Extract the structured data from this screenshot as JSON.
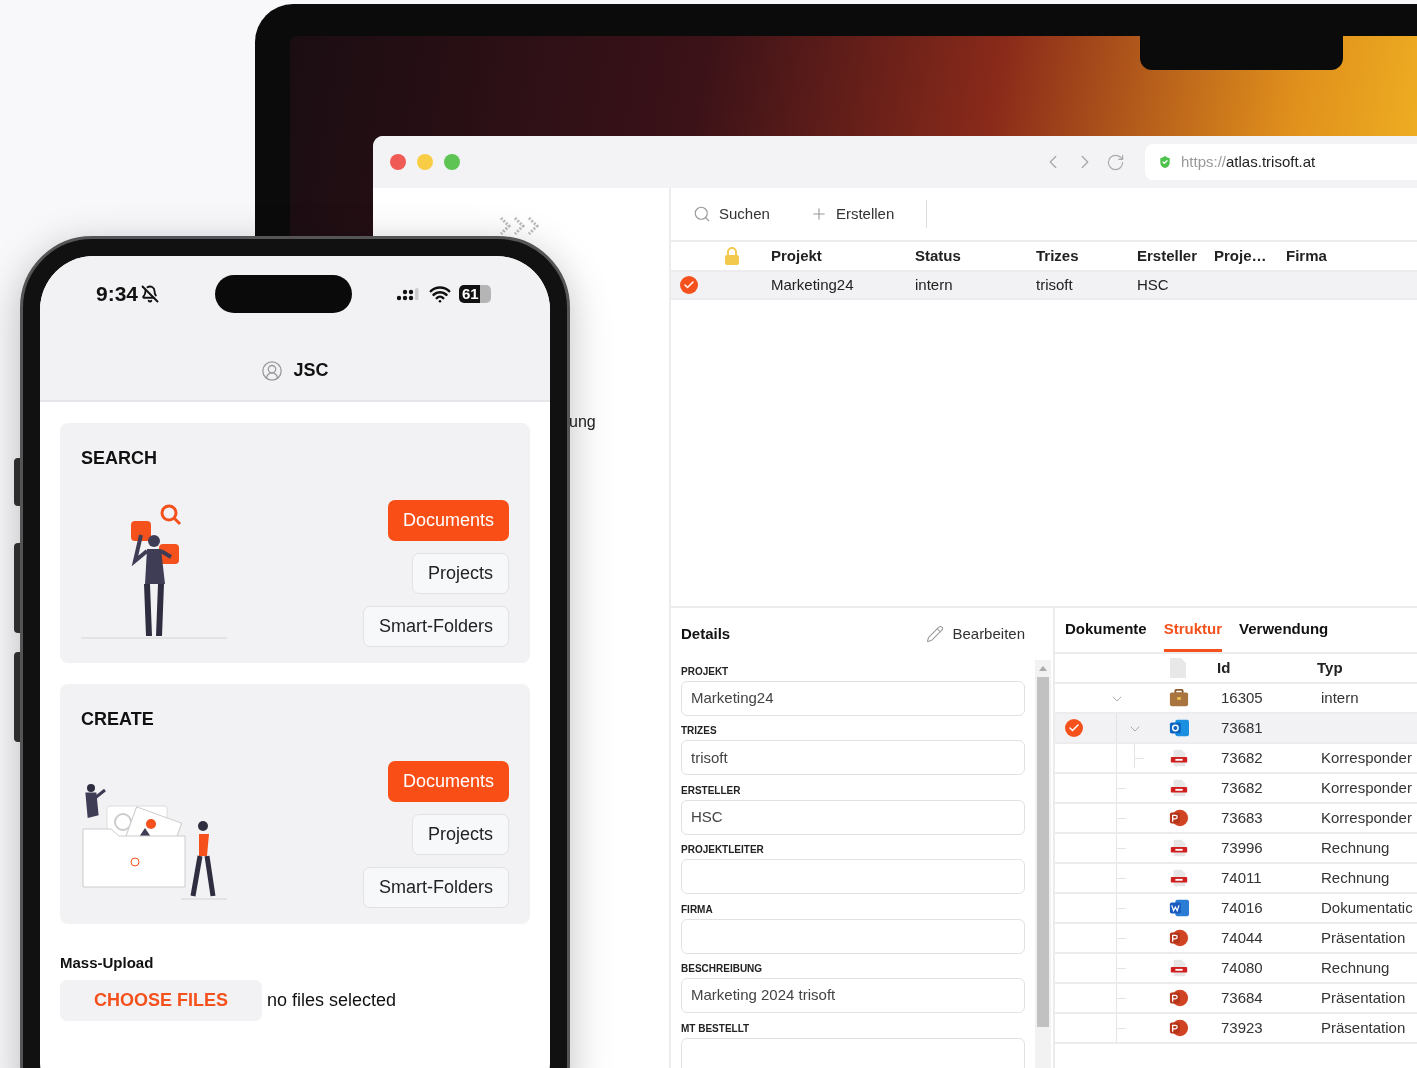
{
  "browser": {
    "url_scheme": "https://",
    "url_host": "atlas.trisoft.at"
  },
  "sidebar": {
    "partial_label": "ung"
  },
  "toolbar": [
    {
      "kind": "search",
      "label": "Suchen"
    },
    {
      "kind": "create",
      "label": "Erstellen"
    }
  ],
  "projects_table": {
    "columns": [
      "Projekt",
      "Status",
      "Trizes",
      "Ersteller",
      "Proje…",
      "Firma"
    ],
    "rows": [
      {
        "selected": true,
        "cells": [
          "Marketing24",
          "intern",
          "trisoft",
          "HSC"
        ]
      }
    ]
  },
  "details": {
    "title": "Details",
    "edit": "Bearbeiten",
    "fields": [
      {
        "label": "PROJEKT",
        "value": "Marketing24"
      },
      {
        "label": "TRIZES",
        "value": "trisoft"
      },
      {
        "label": "ERSTELLER",
        "value": "HSC"
      },
      {
        "label": "PROJEKTLEITER"
      },
      {
        "label": "FIRMA"
      },
      {
        "label": "BESCHREIBUNG",
        "value": "Marketing 2024 trisoft"
      },
      {
        "label": "MT BESTELLT"
      }
    ]
  },
  "structure": {
    "tabs": [
      {
        "label": "Dokumente",
        "selected": false
      },
      {
        "label": "Struktur",
        "selected": true
      },
      {
        "label": "Verwendung",
        "selected": false
      }
    ],
    "columns": [
      "Id",
      "Typ"
    ],
    "rows": [
      {
        "kind": "briefcase",
        "id": "16305",
        "typ": "intern",
        "selected": false,
        "expanded": true,
        "children": [
          {
            "kind": "outlook",
            "id": "73681",
            "selected": true,
            "expanded": true,
            "children": [
              {
                "kind": "pdf",
                "id": "73682",
                "typ": "Korresponder",
                "selected": false
              }
            ]
          },
          {
            "kind": "pdf",
            "id": "73682",
            "typ": "Korresponder",
            "selected": false
          },
          {
            "kind": "powerpoint",
            "id": "73683",
            "typ": "Korresponder",
            "selected": false
          },
          {
            "kind": "pdf",
            "id": "73996",
            "typ": "Rechnung",
            "selected": false
          },
          {
            "kind": "pdf",
            "id": "74011",
            "typ": "Rechnung",
            "selected": false
          },
          {
            "kind": "word",
            "id": "74016",
            "typ": "Dokumentatic",
            "selected": false
          },
          {
            "kind": "powerpoint",
            "id": "74044",
            "typ": "Präsentation",
            "selected": false
          },
          {
            "kind": "pdf",
            "id": "74080",
            "typ": "Rechnung",
            "selected": false
          },
          {
            "kind": "powerpoint",
            "id": "73684",
            "typ": "Präsentation",
            "selected": false
          },
          {
            "kind": "powerpoint",
            "id": "73923",
            "typ": "Präsentation",
            "selected": false
          }
        ]
      }
    ]
  },
  "phone": {
    "time": "9:34",
    "battery": "61",
    "user": "JSC",
    "sections": [
      {
        "kind": "search",
        "title": "SEARCH",
        "buttons": [
          {
            "label": "Documents",
            "primary": true
          },
          {
            "label": "Projects",
            "primary": false
          },
          {
            "label": "Smart-Folders",
            "primary": false
          }
        ]
      },
      {
        "kind": "create",
        "title": "CREATE",
        "buttons": [
          {
            "label": "Documents",
            "primary": true
          },
          {
            "label": "Projects",
            "primary": false
          },
          {
            "label": "Smart-Folders",
            "primary": false
          }
        ]
      }
    ],
    "upload": {
      "label": "Mass-Upload",
      "button": "CHOOSE FILES",
      "status": "no files selected"
    }
  }
}
